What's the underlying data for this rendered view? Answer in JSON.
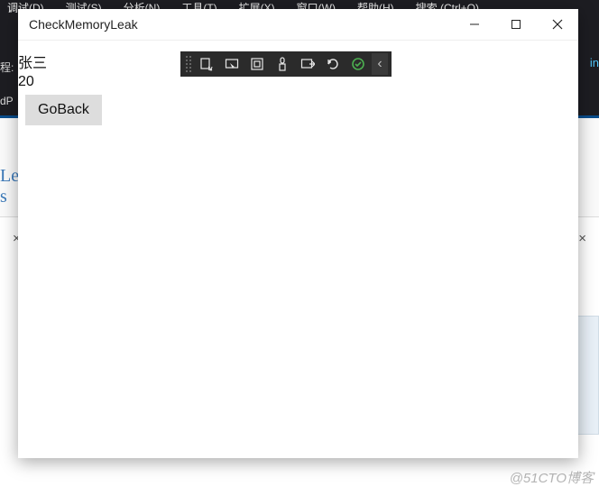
{
  "background": {
    "menu_items": [
      "调试(D)",
      "测试(S)",
      "分析(N)",
      "工具(T)",
      "扩展(X)",
      "窗口(W)",
      "帮助(H)",
      "搜索 (Ctrl+Q)"
    ],
    "left_label_1": "程:",
    "left_label_2": "dP",
    "right_link": "in",
    "side_text": "Le\ns",
    "close_x": "×",
    "watermark": "@51CTO博客"
  },
  "window": {
    "title": "CheckMemoryLeak",
    "buttons": {
      "minimize_tooltip": "Minimize",
      "maximize_tooltip": "Maximize",
      "close_tooltip": "Close"
    }
  },
  "content": {
    "name": "张三",
    "age": "20",
    "goback_label": "GoBack"
  },
  "diag_toolbar": {
    "items": [
      {
        "name": "live-visual-tree-icon"
      },
      {
        "name": "select-element-icon"
      },
      {
        "name": "display-layout-adorners-icon"
      },
      {
        "name": "track-focused-element-icon"
      },
      {
        "name": "go-to-live-visual-tree-icon"
      },
      {
        "name": "hot-reload-icon"
      },
      {
        "name": "status-ok-icon"
      }
    ],
    "expand_arrow": "‹"
  }
}
